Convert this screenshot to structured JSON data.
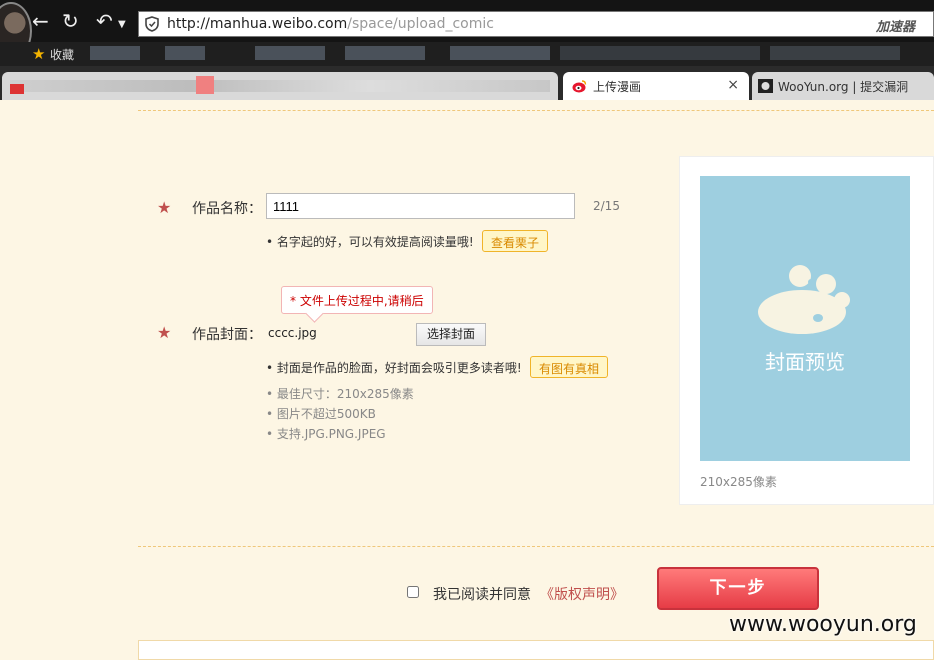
{
  "browser": {
    "url_host": "http://manhua.weibo.com",
    "url_path": "/space/upload_comic",
    "accelerator_label": "加速器",
    "bookmarks_label": "收藏",
    "tabs": [
      {
        "title": "上传漫画",
        "active": true
      },
      {
        "title": "WooYun.org | 提交漏洞",
        "active": false
      }
    ],
    "tab_close": "×"
  },
  "form": {
    "name_label": "作品名称：",
    "name_value": "1111",
    "name_counter": "2/15",
    "name_hint": "• 名字起的好，可以有效提高阅读量哦!",
    "name_example_btn": "查看栗子",
    "upload_tooltip": "* 文件上传过程中,请稍后",
    "cover_label": "作品封面：",
    "cover_filename": "cccc.jpg",
    "choose_cover_btn": "选择封面",
    "cover_hint": "• 封面是作品的脸面，好封面会吸引更多读者哦!",
    "cover_example_btn": "有图有真相",
    "cover_rules": [
      "• 最佳尺寸：210x285像素",
      "• 图片不超过500KB",
      "• 支持.JPG.PNG.JPEG"
    ]
  },
  "preview": {
    "title": "封面预览",
    "size_note": "210x285像素",
    "bg_color": "#9ecfe0"
  },
  "footer": {
    "agree_text": "我已阅读并同意",
    "agree_link": "《版权声明》",
    "agree_checked": false,
    "next_button": "下一步"
  },
  "watermark": "www.wooyun.org",
  "colors": {
    "accent_red": "#e63c46",
    "star_red": "#c0504d",
    "tag_orange": "#f0b429"
  }
}
